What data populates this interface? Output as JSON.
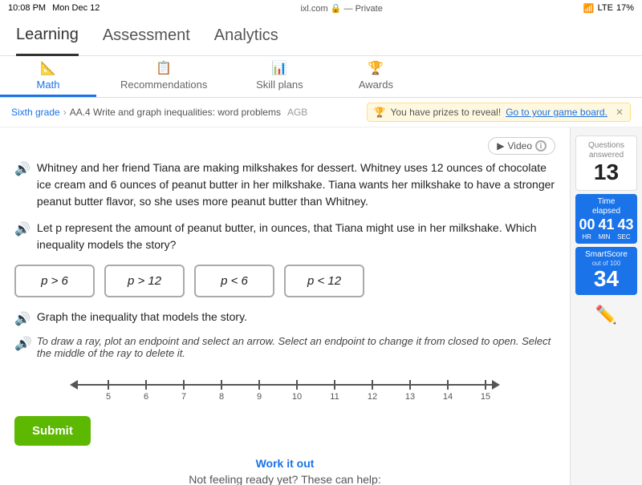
{
  "statusBar": {
    "time": "10:08 PM",
    "day": "Mon Dec 12",
    "url": "ixl.com",
    "privacy": "Private",
    "battery": "17%"
  },
  "topNav": {
    "items": [
      {
        "id": "learning",
        "label": "Learning",
        "active": true
      },
      {
        "id": "assessment",
        "label": "Assessment",
        "active": false
      },
      {
        "id": "analytics",
        "label": "Analytics",
        "active": false
      }
    ]
  },
  "subNav": {
    "items": [
      {
        "id": "math",
        "label": "Math",
        "icon": "📐",
        "active": true
      },
      {
        "id": "recommendations",
        "label": "Recommendations",
        "icon": "📋",
        "active": false
      },
      {
        "id": "skill-plans",
        "label": "Skill plans",
        "icon": "📊",
        "active": false
      },
      {
        "id": "awards",
        "label": "Awards",
        "icon": "🏆",
        "active": false
      }
    ]
  },
  "breadcrumb": {
    "grade": "Sixth grade",
    "skill": "AA.4 Write and graph inequalities: word problems",
    "code": "AGB",
    "prize_text": "You have prizes to reveal!",
    "prize_link": "Go to your game board."
  },
  "video": {
    "label": "Video"
  },
  "problem": {
    "text": "Whitney and her friend Tiana are making milkshakes for dessert. Whitney uses 12 ounces of chocolate ice cream and 6 ounces of peanut butter in her milkshake. Tiana wants her milkshake to have a stronger peanut butter flavor, so she uses more peanut butter than Whitney.",
    "question": "Let p represent the amount of peanut butter, in ounces, that Tiana might use in her milkshake. Which inequality models the story?",
    "answers": [
      {
        "id": "a1",
        "label": "p > 6"
      },
      {
        "id": "a2",
        "label": "p > 12"
      },
      {
        "id": "a3",
        "label": "p < 6"
      },
      {
        "id": "a4",
        "label": "p < 12"
      }
    ],
    "graph_instruction": "Graph the inequality that models the story.",
    "draw_hint": "To draw a ray, plot an endpoint and select an arrow. Select an endpoint to change it from closed to open. Select the middle of the ray to delete it.",
    "number_line": {
      "min": 5,
      "max": 15,
      "values": [
        5,
        6,
        7,
        8,
        9,
        10,
        11,
        12,
        13,
        14,
        15
      ]
    }
  },
  "submitBtn": {
    "label": "Submit"
  },
  "workItOut": {
    "title": "Work it out",
    "subtitle": "Not feeling ready yet? These can help:"
  },
  "rightPanel": {
    "questions_label": "Questions\nanswered",
    "questions_count": "13",
    "time_label": "Time\nelapsed",
    "time_hr": "00",
    "time_min": "41",
    "time_sec": "43",
    "hr_label": "HR",
    "min_label": "MIN",
    "sec_label": "SEC",
    "smart_score_label": "SmartScore",
    "smart_score_sub": "out of 100",
    "smart_score_value": "34"
  }
}
